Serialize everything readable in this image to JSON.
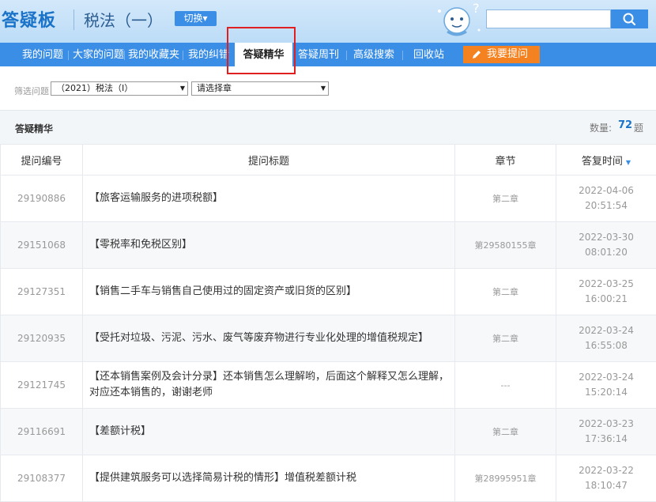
{
  "header": {
    "logo": "答疑板",
    "subject": "税法（一）",
    "switch_label": "切换▾",
    "search_placeholder": ""
  },
  "nav": {
    "items": [
      "我的问题",
      "大家的问题",
      "我的收藏夹",
      "我的纠错",
      "答疑精华",
      "答疑周刊",
      "高级搜索",
      "回收站"
    ],
    "active_index": 4,
    "ask_label": "我要提问"
  },
  "filter": {
    "label": "筛选问题",
    "course": "（2021）税法（Ⅰ）",
    "chapter": "请选择章"
  },
  "section": {
    "title": "答疑精华",
    "count_label": "数量:",
    "count": "72",
    "count_unit": "题"
  },
  "table": {
    "headers": [
      "提问编号",
      "提问标题",
      "章节",
      "答复时间"
    ],
    "rows": [
      {
        "id": "29190886",
        "title": "【旅客运输服务的进项税额】",
        "chapter": "第二章",
        "date": "2022-04-06",
        "time": "20:51:54"
      },
      {
        "id": "29151068",
        "title": "【零税率和免税区别】",
        "chapter": "第29580155章",
        "date": "2022-03-30",
        "time": "08:01:20"
      },
      {
        "id": "29127351",
        "title": "【销售二手车与销售自己使用过的固定资产或旧货的区别】",
        "chapter": "第二章",
        "date": "2022-03-25",
        "time": "16:00:21"
      },
      {
        "id": "29120935",
        "title": "【受托对垃圾、污泥、污水、废气等废弃物进行专业化处理的增值税规定】",
        "chapter": "第二章",
        "date": "2022-03-24",
        "time": "16:55:08"
      },
      {
        "id": "29121745",
        "title": "【还本销售案例及会计分录】还本销售怎么理解哟，后面这个解释又怎么理解，对应还本销售的，谢谢老师",
        "chapter": "---",
        "date": "2022-03-24",
        "time": "15:20:14"
      },
      {
        "id": "29116691",
        "title": "【差额计税】",
        "chapter": "第二章",
        "date": "2022-03-23",
        "time": "17:36:14"
      },
      {
        "id": "29108377",
        "title": "【提供建筑服务可以选择简易计税的情形】增值税差额计税",
        "chapter": "第28995951章",
        "date": "2022-03-22",
        "time": "18:10:47"
      }
    ]
  },
  "colors": {
    "brand_blue": "#3a8ee6",
    "accent_orange": "#f58220",
    "highlight_red": "#e02020"
  }
}
